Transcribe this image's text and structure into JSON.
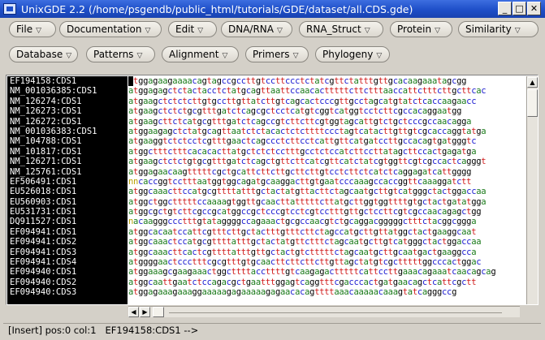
{
  "window": {
    "title": "UnixGDE 2.2 (/home/psgendb/public_html/tutorials/GDE/dataset/all.CDS.gde)",
    "minimize_glyph": "_",
    "maximize_glyph": "□",
    "close_glyph": "✕"
  },
  "menus": {
    "row1": [
      "File",
      "Documentation",
      "Edit",
      "DNA/RNA",
      "RNA_Struct",
      "Protein",
      "Similarity"
    ],
    "row2": [
      "Database",
      "Patterns",
      "Alignment",
      "Primers",
      "Phylogeny"
    ],
    "arrow": "▽"
  },
  "sequences": {
    "names": [
      "EF194158:CDS1",
      "NM_001036385:CDS1",
      "NM_126274:CDS1",
      "NM_126273:CDS1",
      "NM_126272:CDS1",
      "NM_001036383:CDS1",
      "NM_104788:CDS1",
      "NM_101817:CDS1",
      "NM_126271:CDS1",
      "NM_125761:CDS1",
      "EF506491:CDS1",
      "EU526018:CDS1",
      "EU560903:CDS1",
      "EU531731:CDS1",
      "DQ911527:CDS1",
      "EF094941:CDS1",
      "EF094941:CDS2",
      "EF094941:CDS3",
      "EF094941:CDS4",
      "EF094940:CDS1",
      "EF094940:CDS2",
      "EF094940:CDS3"
    ],
    "bases": [
      "atggagaagaaaacagtagccgccttgtccttccctctatcgttctatttgttgcacaagaaatagcgg",
      "atggagagctctactacctctatgcagttaattccaacactttttcttctttaaccattctttcttgcttcac",
      "atgaagctctctcttgtgccttgttatcttgtcagcactcccgttgcctagcatgtatctcaccaagaacc",
      "atgaagctctctgcgtttgatctcagcgctcctcatgtcggtcatggtcctcttcgccacaggaatgg",
      "atgaagcttctcatgcgtttgatctcagccgtcttcttcgtggtagcattgtctgctcccgccaacagga",
      "atggaagagctctatgcagttaatctctacactctcttttccctagtcatacttgttgtcgcaccaggtatga",
      "atgaaggtctctcctcgtttgaactcagccctcttcctcattgttcatgatccttgccacagtgatgggtc",
      "atggctttctttcacacacttatgctctctcctttgcctctccatcttccttatagcttccactgagatga",
      "atgaagctctctgtgcgtttgatctcagctgttcttcatcgttcatctatcgtggttcgtcgccactcagggt",
      "atggagaacaagtttttcgctgcattcttcttgcttcttgtcctcttctcatctcaggagatcattgggg",
      "nncaccggtcctttaatggtggcagatgcaaggacttgtgaatcccaaagccaccggttcaaaggatctt",
      "atggcaaacttccatgcgttttatttgctactatgttacttctagcaatgcttgtcatgggctactggaccaa",
      "atggctggctttttccaaaagtggttgcaacttatttttcttatgcttggtggttttgtgctactgatatgga",
      "atggcgctgtcttcgccgcatggccgctcccgtcctcgtcctttgttgctccttcgtcgccaacagagctgg",
      "nacaagggccctttgtataggggccagaaactgcgccaacgtctgcaggacgggggctttctacggcggga",
      "atggcacaatccattcgtttcttgctactttgtttcttctagccatgcttgttatggctactgaaggcaat",
      "atggcaaactccatgcgttttatttgctactatgttctttctagcaatgcttgtcatgggctactggaccaa",
      "atggcaaacttcactcgttttatttgttgctactgtctttttctagcaatgcttgcaatgactgaaggcca",
      "atggggaactccctttcgcgtttgtgcaacttcttcttcttgttagctatgtcgctttttggcccactggac",
      "atggaaagcgaagaaactggcttttaccttttgtcaagagactttttcattccttgaaacagaaatcaacagcag",
      "atggcaattgaatctccagacgctgaatttggagtcaggtttcgacccactgatgaacagctcattcgctt",
      "atggagaaagaaaggaaaaagagaaaaagagaacacagttttaaacaaaaacaaagtatcagggccg"
    ]
  },
  "status": {
    "mode": "[Insert]",
    "position": "pos:0 col:1",
    "current_sequence": "EF194158:CDS1",
    "arrow": "-->"
  },
  "colors": {
    "a": "#1a7a1a",
    "c": "#1a1ad0",
    "g": "#000000",
    "t": "#d01a1a",
    "n": "#b8a000",
    "titlebar": "#1e4fc8",
    "names_bg": "#000000"
  }
}
